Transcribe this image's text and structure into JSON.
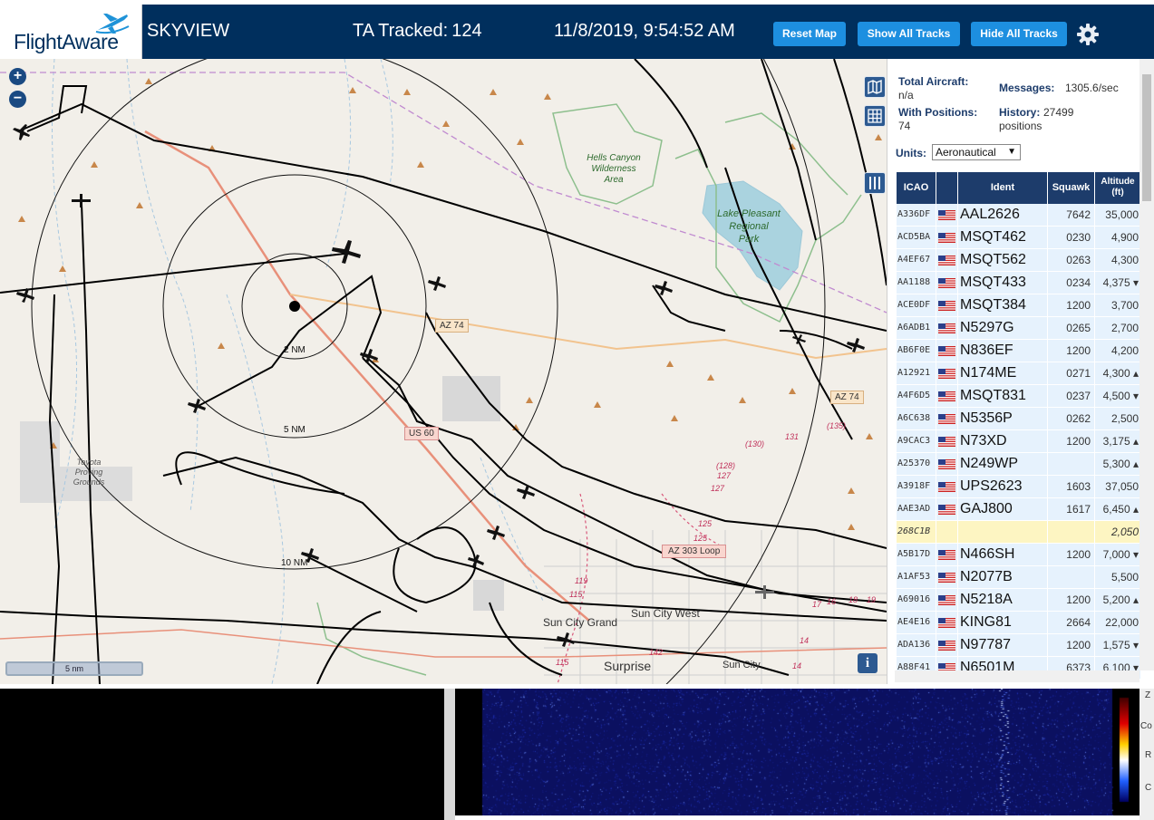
{
  "header": {
    "logo_text": "FlightAware",
    "title": "SKYVIEW",
    "tracked_label": "TA Tracked:",
    "tracked_count": "124",
    "datetime": "11/8/2019, 9:54:52 AM",
    "buttons": {
      "reset_map": "Reset Map",
      "show_all": "Show All Tracks",
      "hide_all": "Hide All Tracks"
    },
    "settings_icon": "gear-icon",
    "background": "#002f5d",
    "button_color": "#1d8fe0"
  },
  "map": {
    "zoom_in": "+",
    "zoom_out": "−",
    "scale_label": "5 nm",
    "info": "i",
    "range_labels": {
      "r2": "2 NM",
      "r5": "5 NM",
      "r10": "10 NM"
    },
    "road_labels": {
      "az74_a": "AZ 74",
      "az74_b": "AZ 74",
      "us60": "US 60",
      "az303": "AZ 303 Loop"
    },
    "place_labels": {
      "hells_canyon": [
        "Hells Canyon",
        "Wilderness",
        "Area"
      ],
      "lake_pleasant": [
        "Lake Pleasant",
        "Regional",
        "Park"
      ],
      "toyota": [
        "Toyota",
        "Proving",
        "Grounds"
      ],
      "sun_city_grand": "Sun City Grand",
      "sun_city_west": "Sun City West",
      "surprise": "Surprise",
      "sun_city": "Sun City"
    },
    "route_numbers": [
      "(135)",
      "(130)",
      "131",
      "(128)",
      "127",
      "127",
      "125",
      "125",
      "119",
      "115",
      "142",
      "115",
      "14",
      "14",
      "17",
      "16",
      "18",
      "19"
    ]
  },
  "stats": {
    "total_aircraft_label": "Total Aircraft:",
    "total_aircraft_value": "n/a",
    "with_positions_label": "With Positions:",
    "with_positions_value": "74",
    "messages_label": "Messages:",
    "messages_value": "1305.6/sec",
    "history_label": "History:",
    "history_value": "27499",
    "history_unit": "positions"
  },
  "units": {
    "label": "Units:",
    "selected": "Aeronautical"
  },
  "table": {
    "headers": {
      "icao": "ICAO",
      "ident": "Ident",
      "squawk": "Squawk",
      "altitude": "Altitude",
      "altitude_unit": "(ft)"
    },
    "rows": [
      {
        "icao": "A336DF",
        "flag": "us",
        "ident": "AAL2626",
        "squawk": "7642",
        "altitude": "35,000"
      },
      {
        "icao": "ACD5BA",
        "flag": "us",
        "ident": "MSQT462",
        "squawk": "0230",
        "altitude": "4,900"
      },
      {
        "icao": "A4EF67",
        "flag": "us",
        "ident": "MSQT562",
        "squawk": "0263",
        "altitude": "4,300"
      },
      {
        "icao": "AA1188",
        "flag": "us",
        "ident": "MSQT433",
        "squawk": "0234",
        "altitude": "4,375 ▾"
      },
      {
        "icao": "ACE0DF",
        "flag": "us",
        "ident": "MSQT384",
        "squawk": "1200",
        "altitude": "3,700"
      },
      {
        "icao": "A6ADB1",
        "flag": "us",
        "ident": "N5297G",
        "squawk": "0265",
        "altitude": "2,700"
      },
      {
        "icao": "AB6F0E",
        "flag": "us",
        "ident": "N836EF",
        "squawk": "1200",
        "altitude": "4,200"
      },
      {
        "icao": "A12921",
        "flag": "us",
        "ident": "N174ME",
        "squawk": "0271",
        "altitude": "4,300 ▴"
      },
      {
        "icao": "A4F6D5",
        "flag": "us",
        "ident": "MSQT831",
        "squawk": "0237",
        "altitude": "4,500 ▾"
      },
      {
        "icao": "A6C638",
        "flag": "us",
        "ident": "N5356P",
        "squawk": "0262",
        "altitude": "2,500"
      },
      {
        "icao": "A9CAC3",
        "flag": "us",
        "ident": "N73XD",
        "squawk": "1200",
        "altitude": "3,175 ▴"
      },
      {
        "icao": "A25370",
        "flag": "us",
        "ident": "N249WP",
        "squawk": "",
        "altitude": "5,300 ▴"
      },
      {
        "icao": "A3918F",
        "flag": "us",
        "ident": "UPS2623",
        "squawk": "1603",
        "altitude": "37,050"
      },
      {
        "icao": "AAE3AD",
        "flag": "us",
        "ident": "GAJ800",
        "squawk": "1617",
        "altitude": "6,450 ▴"
      },
      {
        "icao": "268C1B",
        "flag": "",
        "ident": "",
        "squawk": "",
        "altitude": "2,050",
        "highlight": true
      },
      {
        "icao": "A5B17D",
        "flag": "us",
        "ident": "N466SH",
        "squawk": "1200",
        "altitude": "7,000 ▾"
      },
      {
        "icao": "A1AF53",
        "flag": "us",
        "ident": "N2077B",
        "squawk": "",
        "altitude": "5,500"
      },
      {
        "icao": "A69016",
        "flag": "us",
        "ident": "N5218A",
        "squawk": "1200",
        "altitude": "5,200 ▴"
      },
      {
        "icao": "AE4E16",
        "flag": "us",
        "ident": "KING81",
        "squawk": "2664",
        "altitude": "22,000"
      },
      {
        "icao": "ADA136",
        "flag": "us",
        "ident": "N97787",
        "squawk": "1200",
        "altitude": "1,575 ▾"
      },
      {
        "icao": "A88F41",
        "flag": "us",
        "ident": "N6501M",
        "squawk": "6373",
        "altitude": "6,100 ▾"
      }
    ]
  },
  "waterfall_side": {
    "z": "Z",
    "co": "Co",
    "r": "R",
    "c": "C"
  }
}
